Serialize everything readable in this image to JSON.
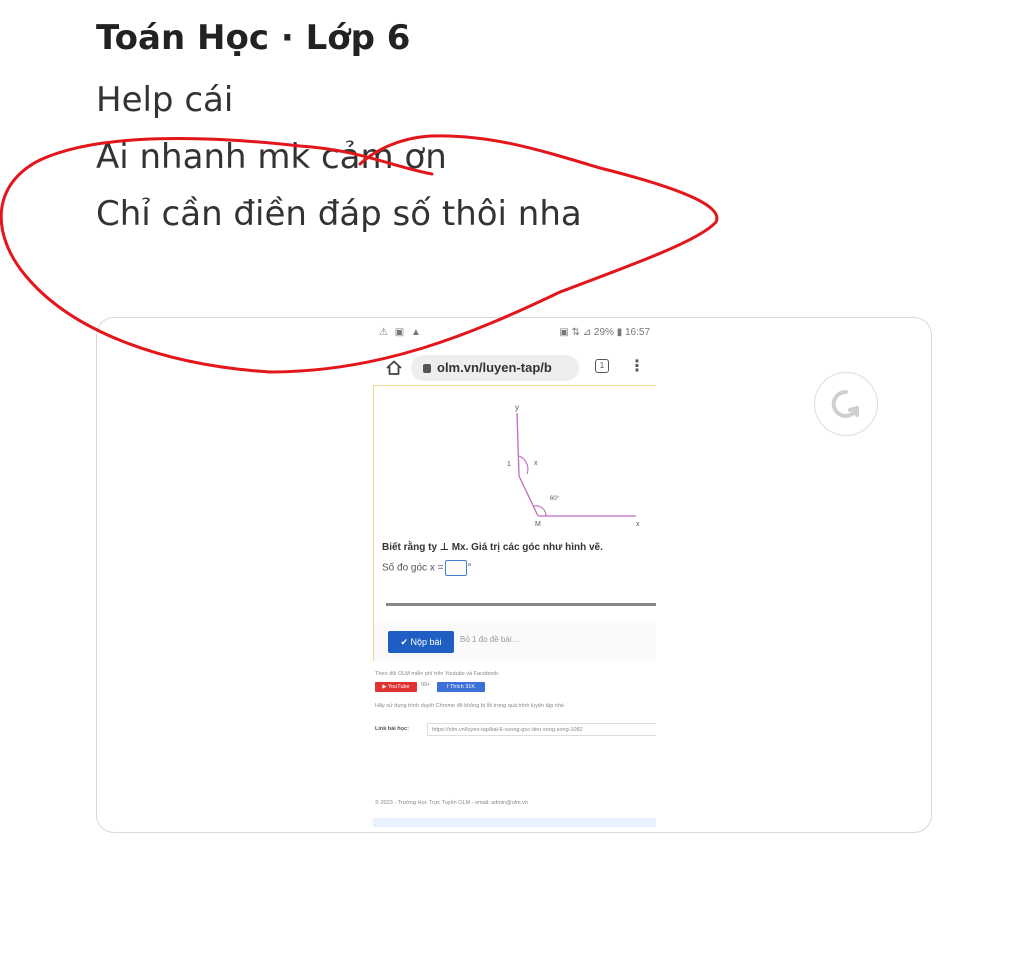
{
  "post": {
    "title": "Toán Học · Lớp 6",
    "lines": [
      "Help cái",
      "Ai nhanh mk cảm ơn",
      "Chỉ cần điền đáp số thôi nha"
    ]
  },
  "annotation": {
    "color": "#e3161b"
  },
  "attachment": {
    "phone": {
      "status_left": "⚠ ▣ ▲",
      "status_right": "▣ ⇅ ⊿ 29% ▮ 16:57",
      "url": "olm.vn/luyen-tap/b",
      "tabs_count": "1",
      "figure_labels": {
        "y": "y",
        "x": "x",
        "m": "M",
        "angle_x": "x",
        "angle_1": "1",
        "angle_deg": "60°"
      },
      "problem": "Biết rằng ty ⊥ Mx. Giá trị các góc như hình vẽ.",
      "answer_label": "Số đo góc x =",
      "answer_unit": "°",
      "submit_label": "✔ Nộp bài",
      "skip_label": "Bỏ 1 đo đề bài…",
      "follow_note": "Theo dõi OLM miễn phí trên Youtube và Facebook:",
      "youtube_label": "▶ YouTube",
      "youtube_count": "99+",
      "facebook_label": "f Thích 31K",
      "chrome_note": "Hãy sử dụng trình duyệt Chrome để không bị lỗi trong quá trình luyện tập nhé",
      "link_label": "Link bài học:",
      "link_value": "https://olm.vn/luyen-tap/bai-6-vuong-goc-den-song-song-1082",
      "footer_note": "© 2023 - Trường Học Trực Tuyến OLM - email: admin@olm.vn"
    }
  }
}
